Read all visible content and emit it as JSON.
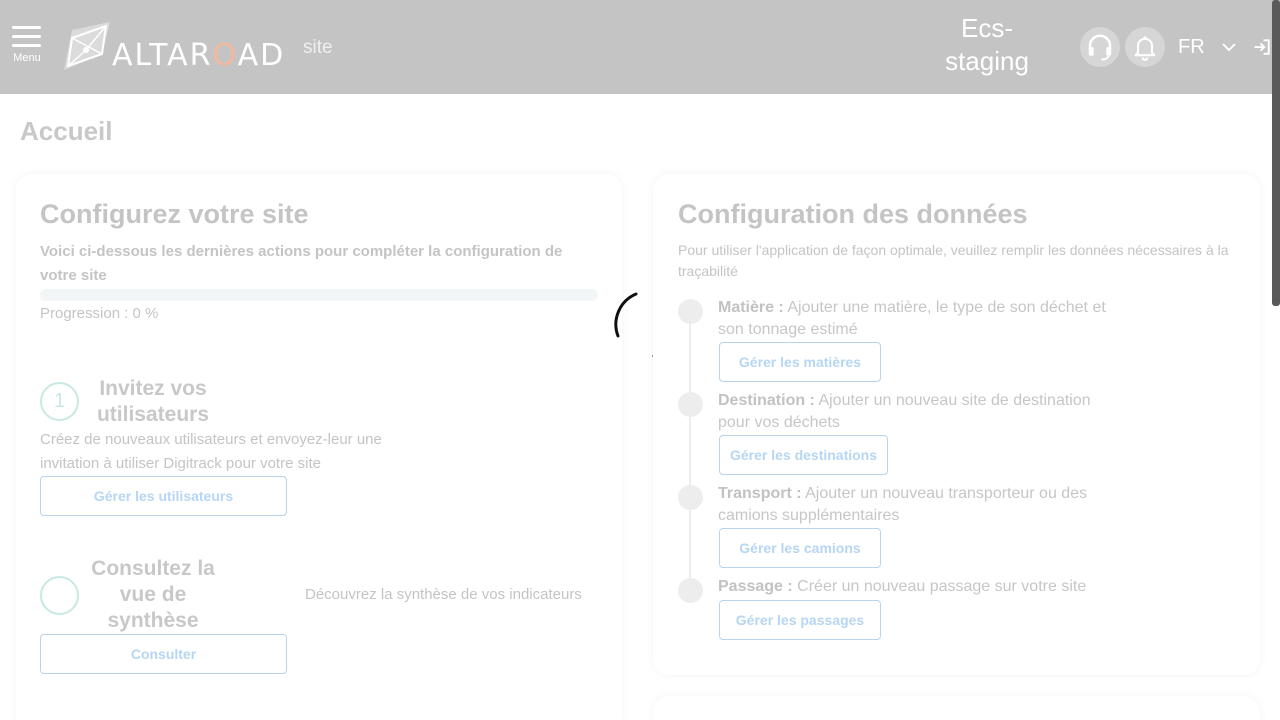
{
  "header": {
    "menu_label": "Menu",
    "logo_text_1": "ALTAR",
    "logo_text_o": "O",
    "logo_text_2": "AD",
    "site_label": "site",
    "environment_line1": "Ecs-",
    "environment_line2": "staging",
    "language": "FR",
    "icons": [
      "hamburger-menu-icon",
      "headset-icon",
      "bell-icon",
      "chevron-down-icon",
      "logout-icon"
    ]
  },
  "page": {
    "title": "Accueil"
  },
  "site_config": {
    "title": "Configurez votre site",
    "subtitle": "Voici ci-dessous les dernières actions pour compléter la configuration de votre site",
    "progress_percent": 0,
    "progress_label": "Progression : 0 %",
    "steps": [
      {
        "number": "1",
        "title": "Invitez vos utilisateurs",
        "description": "Créez de nouveaux utilisateurs et envoyez-leur une invitation à utiliser Digitrack pour votre site",
        "button_label": "Gérer les utilisateurs"
      },
      {
        "number": "",
        "title": "Consultez la vue de synthèse",
        "description": "Découvrez la synthèse de vos indicateurs",
        "button_label": "Consulter"
      }
    ]
  },
  "data_config": {
    "title": "Configuration des données",
    "subtitle": "Pour utiliser l'application de façon optimale, veuillez remplir les données nécessaires à la traçabilité",
    "items": [
      {
        "label": "Matière :",
        "text": " Ajouter une matière, le type de son déchet et son tonnage estimé",
        "button_label": "Gérer les matières"
      },
      {
        "label": "Destination :",
        "text": " Ajouter un nouveau site de destination pour vos déchets",
        "button_label": "Gérer les destinations"
      },
      {
        "label": "Transport :",
        "text": " Ajouter un nouveau transporteur ou des camions supplémentaires",
        "button_label": "Gérer les camions"
      },
      {
        "label": "Passage :",
        "text": " Créer un nouveau passage sur votre site",
        "button_label": "Gérer les passages"
      }
    ]
  },
  "colors": {
    "header_bg": "#c4c4c4",
    "accent_orange": "#f3b89d",
    "button_text": "#b6d6f3",
    "step_circle": "#c9e8e4"
  }
}
